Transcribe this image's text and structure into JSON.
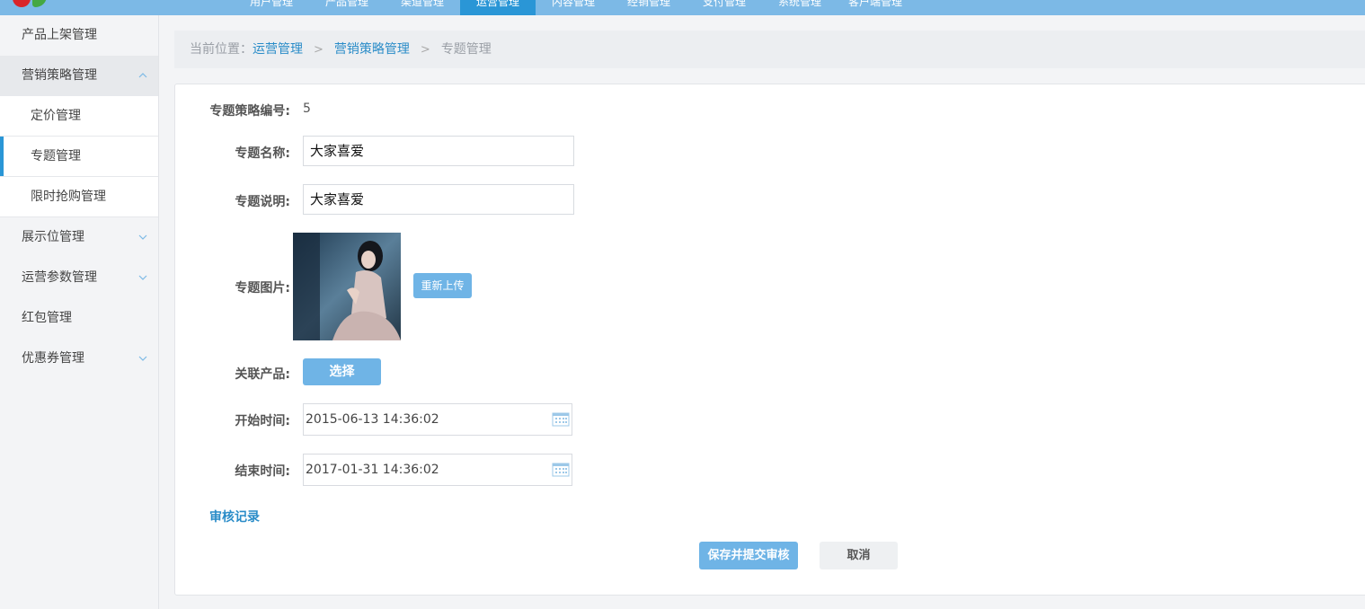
{
  "topnav": {
    "items": [
      {
        "label": "用户管理"
      },
      {
        "label": "产品管理"
      },
      {
        "label": "渠道管理"
      },
      {
        "label": "运营管理"
      },
      {
        "label": "内容管理"
      },
      {
        "label": "经销管理"
      },
      {
        "label": "支付管理"
      },
      {
        "label": "系统管理"
      },
      {
        "label": "客户端管理"
      }
    ],
    "active_index": 3
  },
  "sidebar": {
    "items": [
      {
        "label": "产品上架管理"
      },
      {
        "label": "营销策略管理",
        "expanded": true,
        "children": [
          {
            "label": "定价管理"
          },
          {
            "label": "专题管理",
            "active": true
          },
          {
            "label": "限时抢购管理"
          }
        ]
      },
      {
        "label": "展示位管理"
      },
      {
        "label": "运营参数管理"
      },
      {
        "label": "红包管理"
      },
      {
        "label": "优惠券管理"
      }
    ]
  },
  "breadcrumb": {
    "prefix": "当前位置：",
    "level1": "运营管理",
    "level2": "营销策略管理",
    "current": "专题管理",
    "separator": ">"
  },
  "form": {
    "id_label": "专题策略编号:",
    "id_value": "5",
    "name_label": "专题名称:",
    "name_value": "大家喜爱",
    "desc_label": "专题说明:",
    "desc_value": "大家喜爱",
    "image_label": "专题图片:",
    "reupload_label": "重新上传",
    "product_label": "关联产品:",
    "select_label": "选择",
    "start_label": "开始时间:",
    "start_value": "2015-06-13 14:36:02",
    "end_label": "结束时间:",
    "end_value": "2017-01-31 14:36:02",
    "audit_link": "审核记录",
    "save_label": "保存并提交审核",
    "cancel_label": "取消"
  },
  "colors": {
    "accent": "#2a96d6",
    "button_blue": "#6fb4e6",
    "topbar": "#7cb9e6",
    "link": "#2a8cc8"
  }
}
